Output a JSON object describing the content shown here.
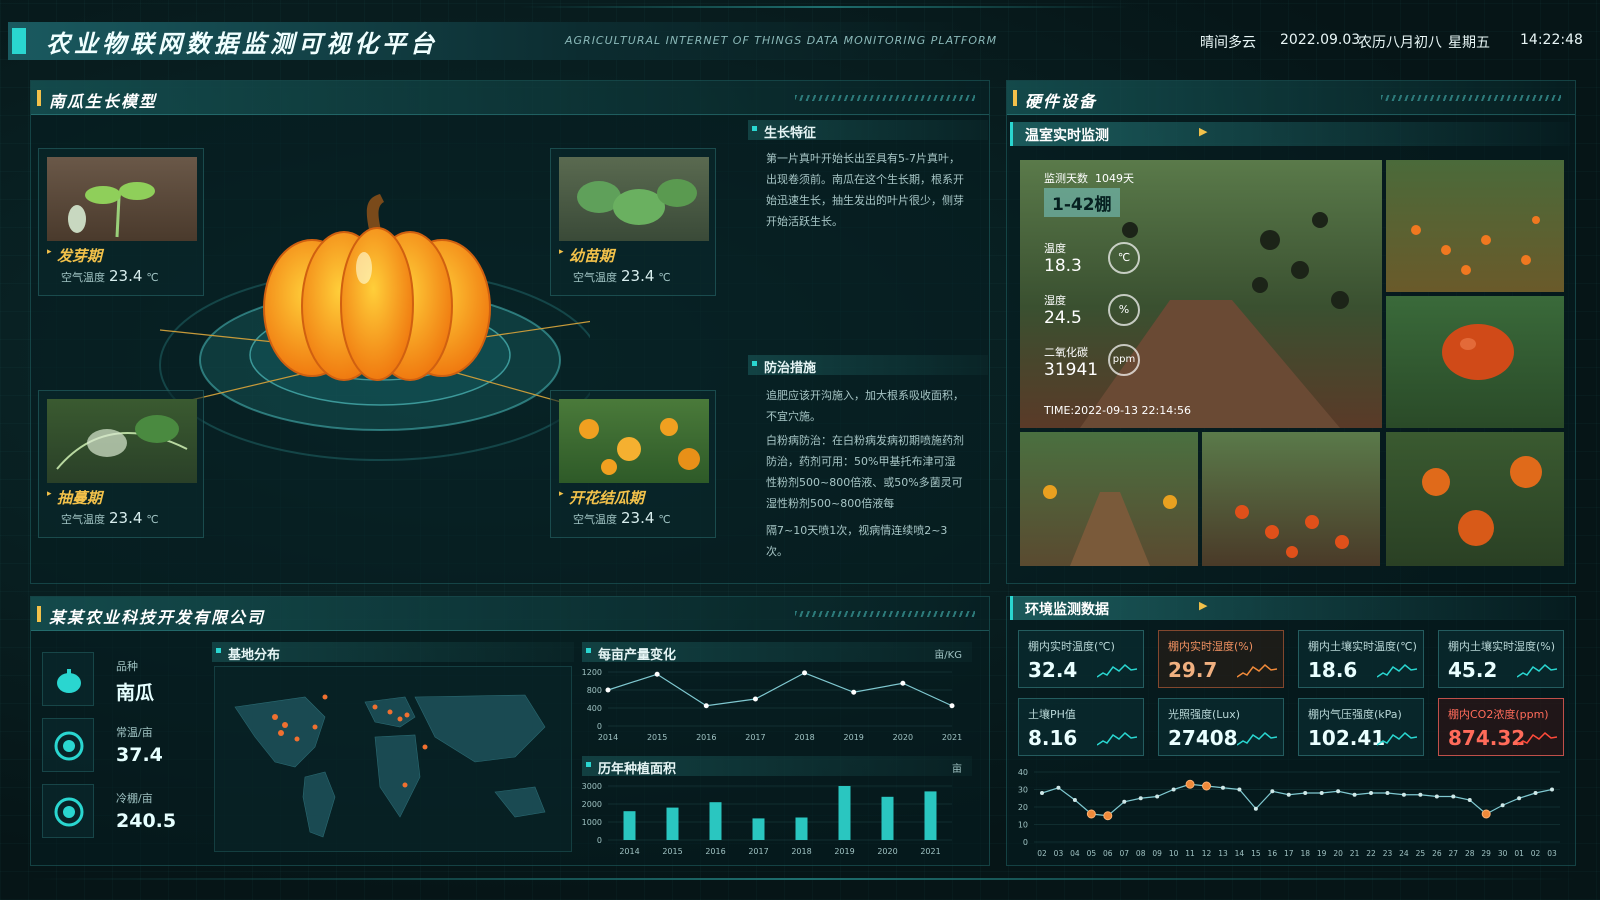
{
  "header": {
    "title": "农业物联网数据监测可视化平台",
    "subtitle": "AGRICULTURAL INTERNET OF THINGS DATA MONITORING PLATFORM",
    "weather": "晴间多云",
    "date": "2022.09.03",
    "lunar": "农历八月初八",
    "weekday": "星期五",
    "time": "14:22:48"
  },
  "growth_panel": {
    "title": "南瓜生长模型",
    "stages": [
      {
        "name": "发芽期",
        "label": "空气温度",
        "value": "23.4",
        "unit": "℃"
      },
      {
        "name": "幼苗期",
        "label": "空气温度",
        "value": "23.4",
        "unit": "℃"
      },
      {
        "name": "抽蔓期",
        "label": "空气温度",
        "value": "23.4",
        "unit": "℃"
      },
      {
        "name": "开花结瓜期",
        "label": "空气温度",
        "value": "23.4",
        "unit": "℃"
      }
    ],
    "features_title": "生长特征",
    "features_text": "第一片真叶开始长出至具有5-7片真叶，出现卷须前。南瓜在这个生长期，根系开始迅速生长，抽生发出的叶片很少，侧芽开始活跃生长。",
    "measures_title": "防治措施",
    "measures_p1": "追肥应该开沟施入，加大根系吸收面积，不宜穴施。",
    "measures_p2": "白粉病防治：在白粉病发病初期喷施药剂防治，药剂可用：50%甲基托布津可湿性粉剂500~800倍液、或50%多菌灵可湿性粉剂500~800倍液每",
    "measures_p3": "隔7~10天喷1次，视病情连续喷2~3次。"
  },
  "hardware_panel": {
    "title": "硬件设备",
    "greenhouse_title": "温室实时监测",
    "monitor_days_label": "监测天数",
    "monitor_days": "1049天",
    "shed": "1-42棚",
    "temp_label": "温度",
    "temp_value": "18.3",
    "temp_unit": "℃",
    "humid_label": "湿度",
    "humid_value": "24.5",
    "humid_unit": "%",
    "co2_label": "二氧化碳",
    "co2_value": "31941",
    "co2_unit": "ppm",
    "timestamp": "TIME:2022-09-13 22:14:56"
  },
  "company_panel": {
    "title": "某某农业科技开发有限公司",
    "variety_label": "品种",
    "variety_value": "南瓜",
    "warm_label": "常温/亩",
    "warm_value": "37.4",
    "cold_label": "冷棚/亩",
    "cold_value": "240.5",
    "map_title": "基地分布",
    "yield_title": "每亩产量变化",
    "yield_unit": "亩/KG",
    "area_title": "历年种植面积",
    "area_unit": "亩"
  },
  "env_panel": {
    "title": "环境监测数据",
    "tiles": [
      {
        "label": "棚内实时温度(℃)",
        "value": "32.4",
        "style": "normal"
      },
      {
        "label": "棚内实时湿度(%)",
        "value": "29.7",
        "style": "orange"
      },
      {
        "label": "棚内土壤实时温度(℃)",
        "value": "18.6",
        "style": "normal"
      },
      {
        "label": "棚内土壤实时湿度(%)",
        "value": "45.2",
        "style": "normal"
      },
      {
        "label": "土壤PH值",
        "value": "8.16",
        "style": "normal"
      },
      {
        "label": "光照强度(Lux)",
        "value": "27408",
        "style": "normal"
      },
      {
        "label": "棚内气压强度(kPa)",
        "value": "102.41",
        "style": "normal"
      },
      {
        "label": "棚内CO2浓度(ppm)",
        "value": "874.32",
        "style": "warn"
      }
    ]
  },
  "colors": {
    "accent": "#2ad6d0",
    "gold": "#f2c14a",
    "alert": "#ff6b5a",
    "orange": "#f08a3a"
  },
  "chart_data": [
    {
      "type": "line",
      "title": "每亩产量变化",
      "x": [
        "2014",
        "2015",
        "2016",
        "2017",
        "2018",
        "2019",
        "2020",
        "2021"
      ],
      "values": [
        800,
        1150,
        450,
        600,
        1180,
        750,
        950,
        450
      ],
      "ylim": [
        0,
        1200
      ],
      "yticks": [
        0,
        400,
        800,
        1200
      ]
    },
    {
      "type": "bar",
      "title": "历年种植面积",
      "categories": [
        "2014",
        "2015",
        "2016",
        "2017",
        "2018",
        "2019",
        "2020",
        "2021"
      ],
      "values": [
        1600,
        1800,
        2100,
        1200,
        1250,
        3000,
        2400,
        2700
      ],
      "ylim": [
        0,
        3000
      ],
      "yticks": [
        0,
        1000,
        2000,
        3000
      ]
    },
    {
      "type": "line",
      "title": "环境监测数据",
      "x": [
        "02",
        "03",
        "04",
        "05",
        "06",
        "07",
        "08",
        "09",
        "10",
        "11",
        "12",
        "13",
        "14",
        "15",
        "16",
        "17",
        "18",
        "19",
        "20",
        "21",
        "22",
        "23",
        "24",
        "25",
        "26",
        "27",
        "28",
        "29",
        "30",
        "01",
        "02",
        "03"
      ],
      "values": [
        28,
        31,
        24,
        16,
        15,
        23,
        25,
        26,
        30,
        33,
        32,
        31,
        30,
        19,
        29,
        27,
        28,
        28,
        29,
        27,
        28,
        28,
        27,
        27,
        26,
        26,
        24,
        16,
        21,
        25,
        28,
        30
      ],
      "highlight": [
        3,
        4,
        9,
        10,
        27
      ],
      "ylim": [
        0,
        40
      ],
      "yticks": [
        0,
        10,
        20,
        30,
        40
      ]
    }
  ]
}
